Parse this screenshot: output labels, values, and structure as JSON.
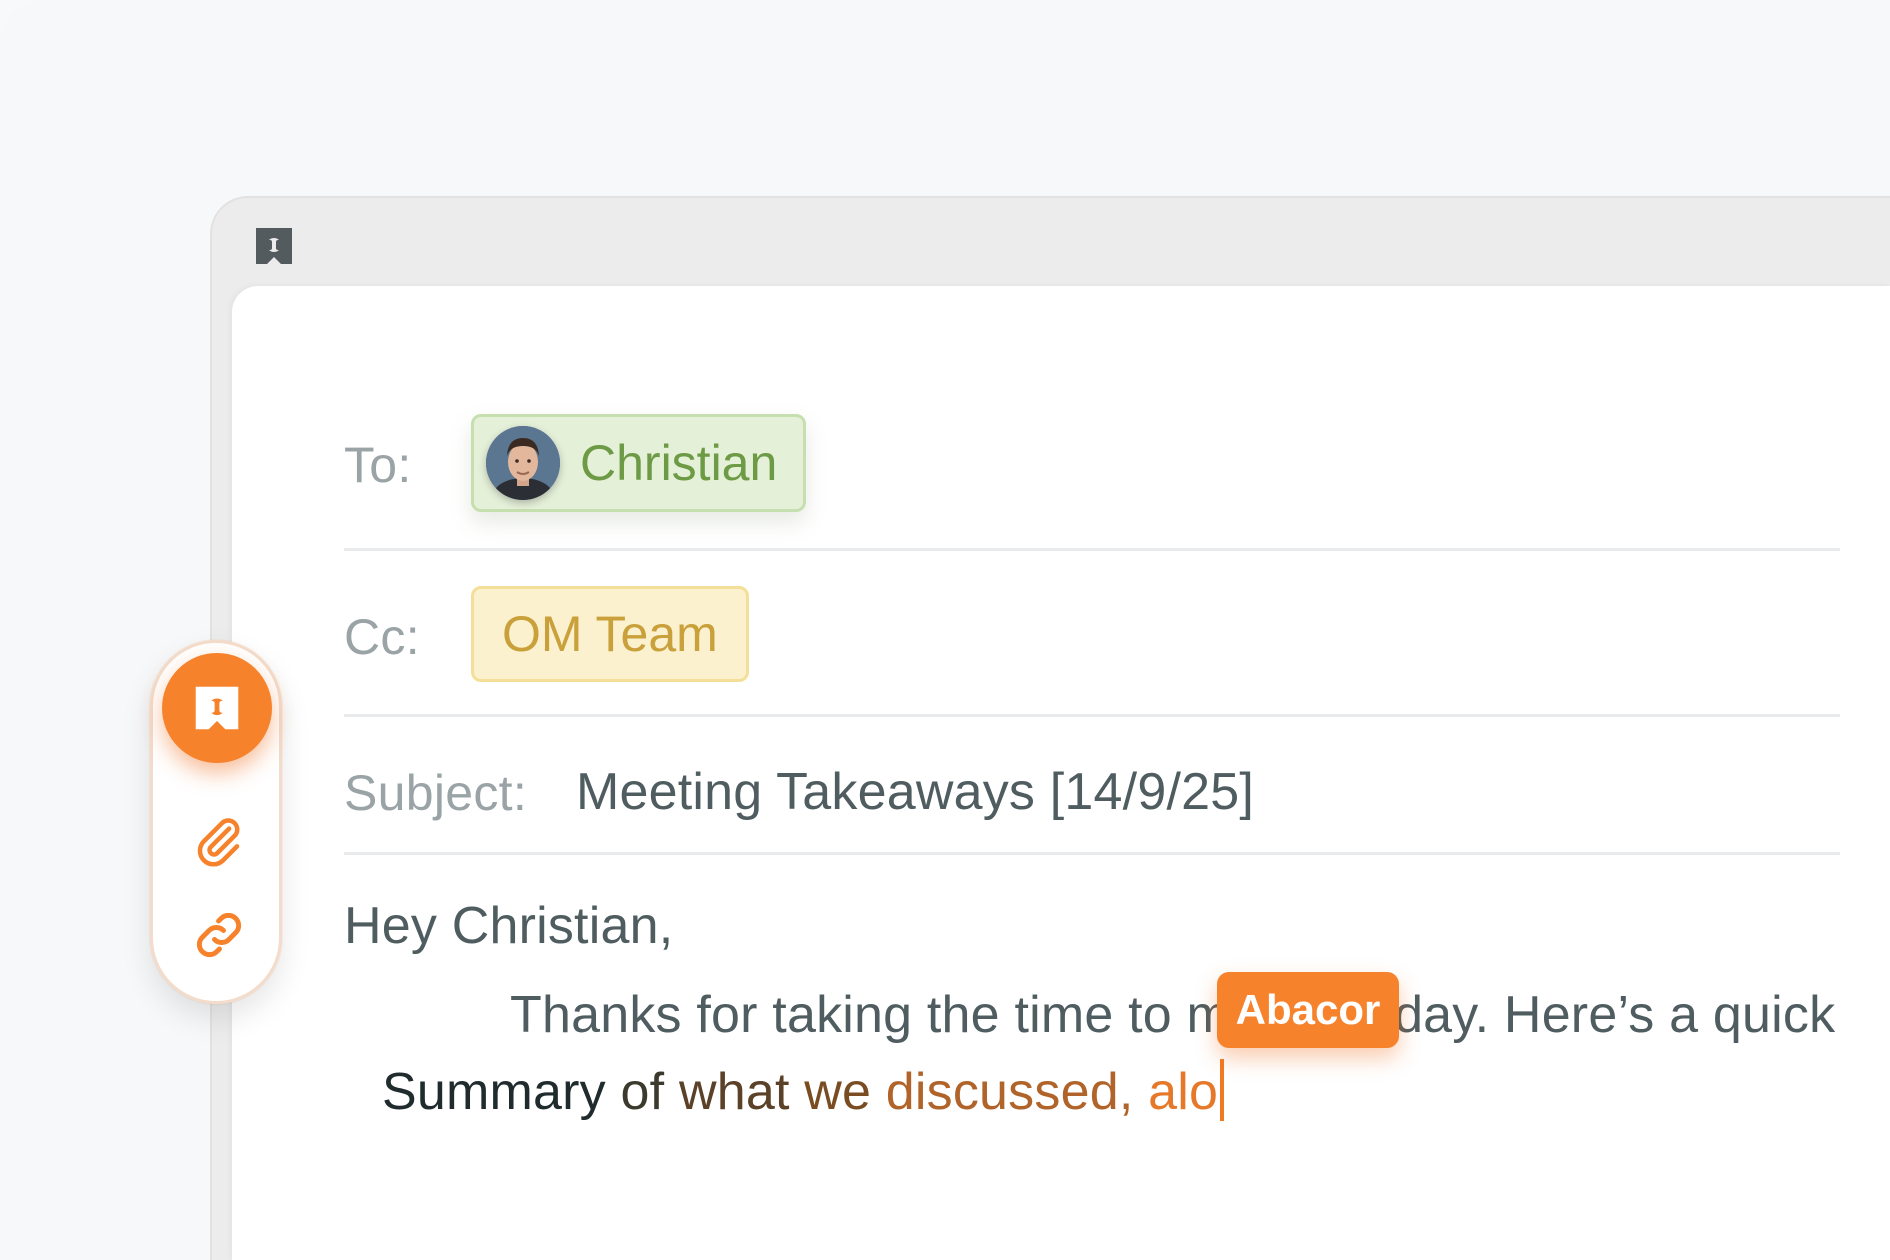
{
  "compose": {
    "to_label": "To:",
    "to_recipient": "Christian",
    "cc_label": "Cc:",
    "cc_recipient": "OM Team",
    "subject_label": "Subject:",
    "subject_value": "Meeting Takeaways [14/9/25]"
  },
  "body": {
    "greeting": "Hey Christian,",
    "line1_part1": "Thanks for taking the time to m",
    "line1_part2": "day. Here’s a quick",
    "line2_words": [
      {
        "text": "Summary ",
        "color": "#1f2b2c"
      },
      {
        "text": "of ",
        "color": "#3b3a2c"
      },
      {
        "text": "what ",
        "color": "#5a4128"
      },
      {
        "text": "we ",
        "color": "#7a4c22"
      },
      {
        "text": "discussed, ",
        "color": "#b0642a"
      },
      {
        "text": "alo",
        "color": "#e6782a"
      }
    ]
  },
  "collaborator": {
    "name": "Abacor",
    "color": "#f7822c"
  },
  "toolbar": {
    "items": [
      {
        "icon": "abacor-logo-icon"
      },
      {
        "icon": "paperclip-icon"
      },
      {
        "icon": "link-icon"
      }
    ]
  },
  "colors": {
    "accent": "#f7822c",
    "to_chip": "#e5f0d9",
    "cc_chip": "#fbf1cf"
  }
}
